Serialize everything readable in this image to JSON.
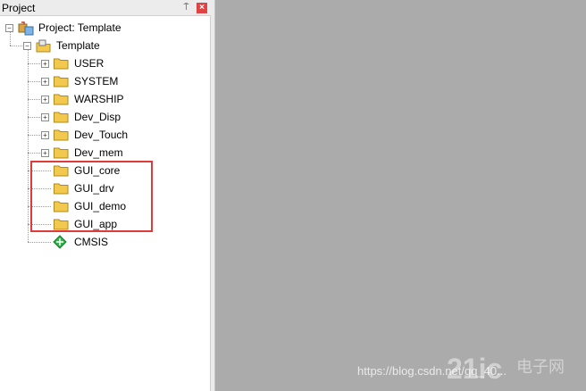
{
  "panel": {
    "title": "Project",
    "pin_glyph": "⍑",
    "close_glyph": "×"
  },
  "tree": {
    "root_label": "Project: Template",
    "target_label": "Template",
    "groups": [
      {
        "label": "USER",
        "expandable": true
      },
      {
        "label": "SYSTEM",
        "expandable": true
      },
      {
        "label": "WARSHIP",
        "expandable": true
      },
      {
        "label": "Dev_Disp",
        "expandable": true
      },
      {
        "label": "Dev_Touch",
        "expandable": true
      },
      {
        "label": "Dev_mem",
        "expandable": true
      },
      {
        "label": "GUI_core",
        "expandable": false
      },
      {
        "label": "GUI_drv",
        "expandable": false
      },
      {
        "label": "GUI_demo",
        "expandable": false
      },
      {
        "label": "GUI_app",
        "expandable": false
      }
    ],
    "component_label": "CMSIS",
    "collapse_glyph": "−",
    "expand_glyph": "+"
  },
  "watermark": {
    "url": "https://blog.csdn.net/qq_40..."
  },
  "colors": {
    "highlight": "#e03a3a",
    "folder": "#f2c94c",
    "cmsis": "#2fb34a"
  },
  "icons": [
    "project-icon",
    "target-icon",
    "folder-icon",
    "cmsis-icon",
    "pin-icon",
    "close-icon"
  ]
}
